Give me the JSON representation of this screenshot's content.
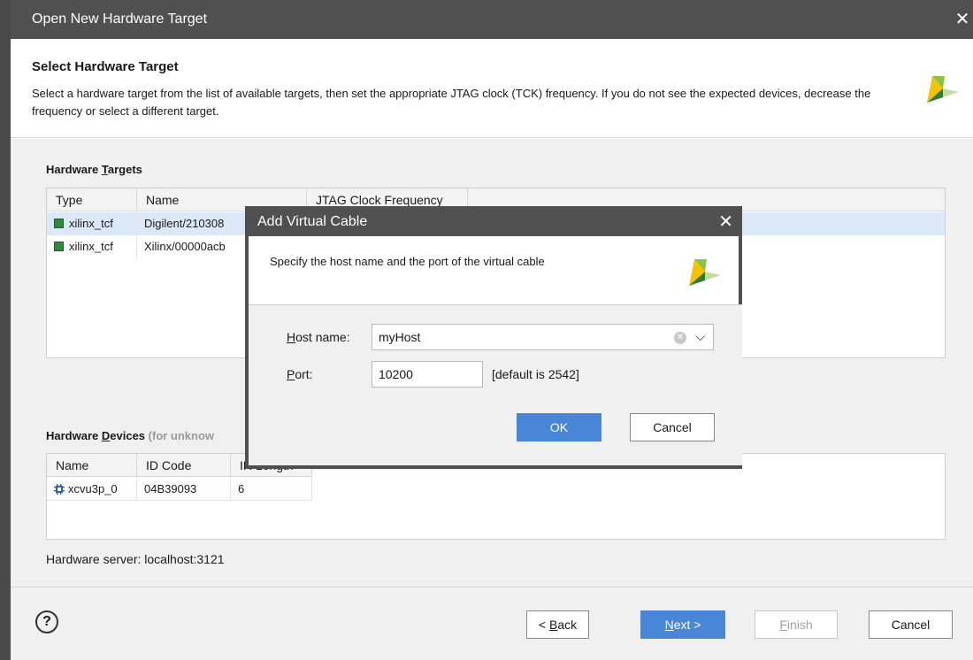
{
  "window": {
    "title": "Open New Hardware Target",
    "close_glyph": "✕"
  },
  "header": {
    "title": "Select Hardware Target",
    "description": "Select a hardware target from the list of available targets, then set the appropriate JTAG clock (TCK) frequency. If you do not see the expected devices, decrease the frequency or select a different target.",
    "logo_icon": "xilinx-logo-icon"
  },
  "targets": {
    "label_pre": "Hardware ",
    "label_u": "T",
    "label_post": "argets",
    "columns": [
      "Type",
      "Name",
      "JTAG Clock Frequency"
    ],
    "rows": [
      {
        "type": "xilinx_tcf",
        "name": "Digilent/210308",
        "selected": true
      },
      {
        "type": "xilinx_tcf",
        "name": "Xilinx/00000acb",
        "selected": false
      }
    ],
    "row_icon": "board-chip-icon"
  },
  "devices": {
    "label_pre": "Hardware ",
    "label_u": "D",
    "label_post": "evices",
    "label_muted": "(for unknow",
    "columns": [
      "Name",
      "ID Code",
      "IR Length"
    ],
    "rows": [
      {
        "name": "xcvu3p_0",
        "id_code": "04B39093",
        "ir_length": "6"
      }
    ],
    "row_icon": "fpga-device-icon"
  },
  "server": {
    "text": "Hardware server: localhost:3121"
  },
  "footer": {
    "help_glyph": "?",
    "back_pre": "< ",
    "back_u": "B",
    "back_post": "ack",
    "next_u": "N",
    "next_post": "ext >",
    "finish_u": "F",
    "finish_post": "inish",
    "cancel": "Cancel"
  },
  "modal": {
    "title": "Add Virtual Cable",
    "close_glyph": "✕",
    "description": "Specify the host name and the port of the virtual cable",
    "host_label_u": "H",
    "host_label_post": "ost name:",
    "host_value": "myHost",
    "port_label_u": "P",
    "port_label_post": "ort:",
    "port_value": "10200",
    "port_hint": "[default is 2542]",
    "ok": "OK",
    "cancel": "Cancel"
  },
  "colors": {
    "titlebar": "#505050",
    "primary_button": "#4a86d8",
    "selected_row": "#dbe8f8",
    "logo_yellow": "#f5c400",
    "logo_green": "#2e7d32"
  }
}
